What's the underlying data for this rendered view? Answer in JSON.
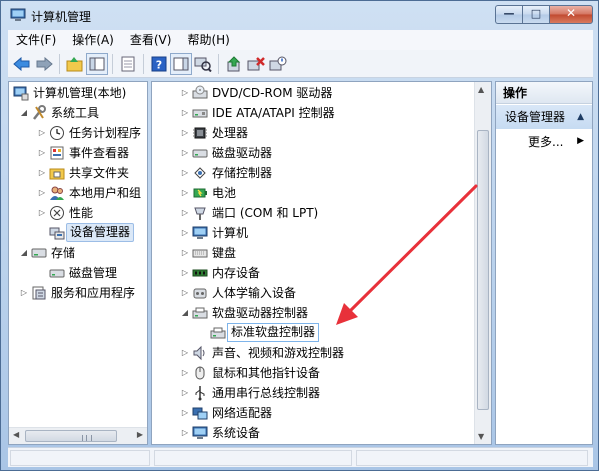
{
  "window": {
    "title": "计算机管理",
    "min_glyph": "—",
    "max_glyph": "□",
    "close_glyph": "✕"
  },
  "menu": [
    "文件(F)",
    "操作(A)",
    "查看(V)",
    "帮助(H)"
  ],
  "toolbar_icons": [
    "back-arrow-icon",
    "forward-arrow-icon",
    "up-folder-icon",
    "console-tree-icon",
    "properties-icon",
    "help-icon",
    "show-hide-icon",
    "scan-hardware-icon",
    "update-driver-icon",
    "uninstall-icon",
    "disable-icon"
  ],
  "left_tree": [
    {
      "label": "计算机管理(本地)",
      "depth": 0,
      "expander": "",
      "icon": "computer-management-icon"
    },
    {
      "label": "系统工具",
      "depth": 1,
      "expander": "◢",
      "icon": "system-tools-icon"
    },
    {
      "label": "任务计划程序",
      "depth": 2,
      "expander": "▷",
      "icon": "task-scheduler-icon"
    },
    {
      "label": "事件查看器",
      "depth": 2,
      "expander": "▷",
      "icon": "event-viewer-icon"
    },
    {
      "label": "共享文件夹",
      "depth": 2,
      "expander": "▷",
      "icon": "shared-folders-icon"
    },
    {
      "label": "本地用户和组",
      "depth": 2,
      "expander": "▷",
      "icon": "local-users-icon"
    },
    {
      "label": "性能",
      "depth": 2,
      "expander": "▷",
      "icon": "performance-icon"
    },
    {
      "label": "设备管理器",
      "depth": 2,
      "expander": "",
      "icon": "device-manager-icon",
      "selected": true
    },
    {
      "label": "存储",
      "depth": 1,
      "expander": "◢",
      "icon": "storage-icon"
    },
    {
      "label": "磁盘管理",
      "depth": 2,
      "expander": "",
      "icon": "disk-management-icon"
    },
    {
      "label": "服务和应用程序",
      "depth": 1,
      "expander": "▷",
      "icon": "services-apps-icon"
    }
  ],
  "devices": [
    {
      "label": "DVD/CD-ROM 驱动器",
      "depth": 0,
      "expander": "▷",
      "icon": "dvd-drive-icon"
    },
    {
      "label": "IDE ATA/ATAPI 控制器",
      "depth": 0,
      "expander": "▷",
      "icon": "ide-controller-icon"
    },
    {
      "label": "处理器",
      "depth": 0,
      "expander": "▷",
      "icon": "processor-icon"
    },
    {
      "label": "磁盘驱动器",
      "depth": 0,
      "expander": "▷",
      "icon": "disk-drive-icon"
    },
    {
      "label": "存储控制器",
      "depth": 0,
      "expander": "▷",
      "icon": "storage-controller-icon"
    },
    {
      "label": "电池",
      "depth": 0,
      "expander": "▷",
      "icon": "battery-icon"
    },
    {
      "label": "端口 (COM 和 LPT)",
      "depth": 0,
      "expander": "▷",
      "icon": "port-icon"
    },
    {
      "label": "计算机",
      "depth": 0,
      "expander": "▷",
      "icon": "computer-icon"
    },
    {
      "label": "键盘",
      "depth": 0,
      "expander": "▷",
      "icon": "keyboard-icon"
    },
    {
      "label": "内存设备",
      "depth": 0,
      "expander": "▷",
      "icon": "memory-icon"
    },
    {
      "label": "人体学输入设备",
      "depth": 0,
      "expander": "▷",
      "icon": "hid-icon"
    },
    {
      "label": "软盘驱动器控制器",
      "depth": 0,
      "expander": "◢",
      "icon": "floppy-controller-icon"
    },
    {
      "label": "标准软盘控制器",
      "depth": 1,
      "expander": "",
      "icon": "floppy-controller-icon",
      "selected": true
    },
    {
      "label": "声音、视频和游戏控制器",
      "depth": 0,
      "expander": "▷",
      "icon": "sound-icon"
    },
    {
      "label": "鼠标和其他指针设备",
      "depth": 0,
      "expander": "▷",
      "icon": "mouse-icon"
    },
    {
      "label": "通用串行总线控制器",
      "depth": 0,
      "expander": "▷",
      "icon": "usb-icon"
    },
    {
      "label": "网络适配器",
      "depth": 0,
      "expander": "▷",
      "icon": "network-adapter-icon"
    },
    {
      "label": "系统设备",
      "depth": 0,
      "expander": "▷",
      "icon": "system-devices-icon"
    }
  ],
  "actions": {
    "header": "操作",
    "section": "设备管理器",
    "section_caret": "▲",
    "more": "更多...",
    "more_caret": "▶"
  },
  "colors": {
    "annotation_arrow": "#e8313a",
    "selection_border": "#7eb4ea"
  }
}
